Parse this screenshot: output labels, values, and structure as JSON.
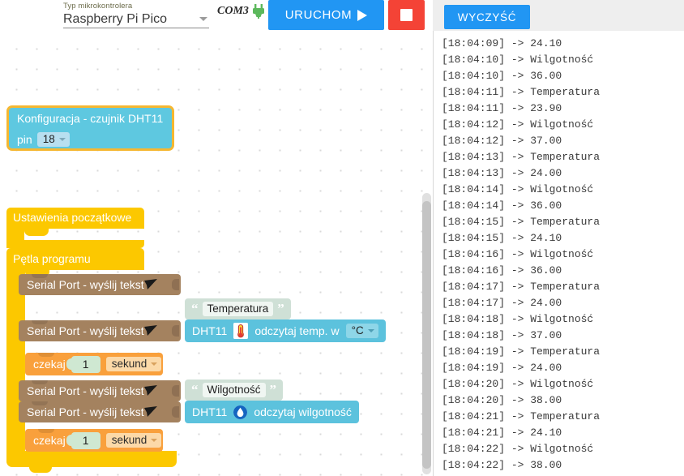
{
  "toolbar": {
    "mcu_label": "Typ mikrokontrolera",
    "mcu_value": "Raspberry Pi Pico",
    "com_port": "COM3",
    "plug_icon": "plug-connected-icon",
    "run_label": "URUCHOM",
    "run_icon": "play-icon",
    "stop_icon": "stop-square-icon",
    "clear_label": "WYCZYŚĆ",
    "accent_blue": "#2196f3",
    "stop_red": "#f44336"
  },
  "blocks": {
    "config": {
      "title": "Konfiguracja - czujnik DHT11",
      "pin_label": "pin",
      "pin_value": "18",
      "fill": "#5ec8e0",
      "border": "#f5b731"
    },
    "setup": {
      "label": "Ustawienia początkowe",
      "fill": "#fcc800"
    },
    "loop": {
      "label": "Pętla programu",
      "fill": "#fcc800"
    },
    "serial_label": "Serial Port - wyślij tekst",
    "serial_icon": "send-arrow-icon",
    "serial_fill": "#a4825f",
    "stack": [
      {
        "kind": "serial-text",
        "text": "Temperatura"
      },
      {
        "kind": "serial-read-temp",
        "device": "DHT11",
        "action": "odczytaj temp. w",
        "unit": "°C",
        "icon": "thermometer-icon"
      },
      {
        "kind": "wait",
        "label": "czekaj",
        "value": "1",
        "unit": "sekund"
      },
      {
        "kind": "serial-text",
        "text": "Wilgotność"
      },
      {
        "kind": "serial-read-humid",
        "device": "DHT11",
        "action": "odczytaj wilgotność",
        "icon": "humidity-icon"
      },
      {
        "kind": "wait",
        "label": "czekaj",
        "value": "1",
        "unit": "sekund"
      }
    ]
  },
  "console": {
    "lines": [
      "[18:04:09] -> 24.10",
      "[18:04:10] -> Wilgotność",
      "[18:04:10] -> 36.00",
      "[18:04:11] -> Temperatura",
      "[18:04:11] -> 23.90",
      "[18:04:12] -> Wilgotność",
      "[18:04:12] -> 37.00",
      "[18:04:13] -> Temperatura",
      "[18:04:13] -> 24.00",
      "[18:04:14] -> Wilgotność",
      "[18:04:14] -> 36.00",
      "[18:04:15] -> Temperatura",
      "[18:04:15] -> 24.10",
      "[18:04:16] -> Wilgotność",
      "[18:04:16] -> 36.00",
      "[18:04:17] -> Temperatura",
      "[18:04:17] -> 24.00",
      "[18:04:18] -> Wilgotność",
      "[18:04:18] -> 37.00",
      "[18:04:19] -> Temperatura",
      "[18:04:19] -> 24.00",
      "[18:04:20] -> Wilgotność",
      "[18:04:20] -> 38.00",
      "[18:04:21] -> Temperatura",
      "[18:04:21] -> 24.10",
      "[18:04:22] -> Wilgotność",
      "[18:04:22] -> 38.00"
    ]
  },
  "labels": {
    "serial_row_1": "Serial Port - wyślij tekst",
    "serial_row_2": "Serial Port - wyślij tekst",
    "serial_row_3": "Serial Port - wyślij tekst",
    "serial_row_4": "Serial Port - wyślij tekst"
  }
}
